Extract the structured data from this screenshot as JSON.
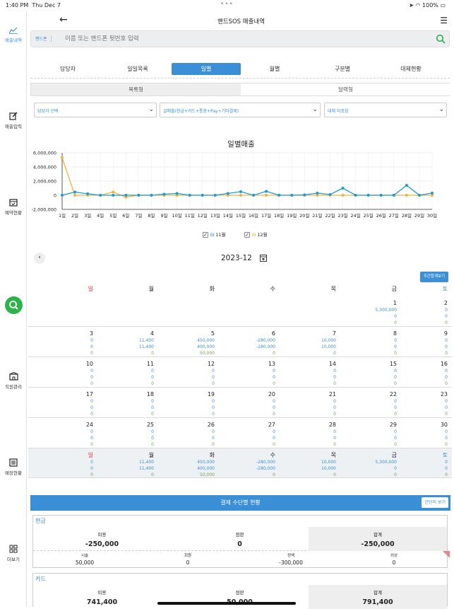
{
  "status": {
    "time": "1:40 PM",
    "date": "Thu Dec 7",
    "battery": "100%"
  },
  "sidebar": {
    "items": [
      {
        "label": "매출내역",
        "icon": "chart-line-icon"
      },
      {
        "label": "매출입력",
        "icon": "edit-icon"
      },
      {
        "label": "예약현황",
        "icon": "calendar-check-icon"
      },
      {
        "label": "",
        "icon": "search-icon"
      },
      {
        "label": "직원관리",
        "icon": "building-icon"
      },
      {
        "label": "매장현황",
        "icon": "list-icon"
      },
      {
        "label": "더보기",
        "icon": "grid-icon"
      }
    ]
  },
  "header": {
    "title": "핸드SOS 매출내역"
  },
  "search": {
    "type": "핸드폰",
    "placeholder": "이름 또는 핸드폰 뒷번호 입력"
  },
  "tabs": [
    "담당자",
    "일일목록",
    "일별",
    "월별",
    "구분별",
    "대체현황"
  ],
  "active_tab": 2,
  "subtabs": [
    "목록형",
    "달력형"
  ],
  "selects": [
    "담당자 선택",
    "실매출(현금+카드+통장+Pay+기타결제)",
    "대체 미포함"
  ],
  "chart_data": {
    "type": "line",
    "title": "일별매출",
    "categories": [
      "1일",
      "2일",
      "3일",
      "4일",
      "5일",
      "6일",
      "7일",
      "8일",
      "9일",
      "10일",
      "11일",
      "12일",
      "13일",
      "14일",
      "15일",
      "16일",
      "17일",
      "18일",
      "19일",
      "20일",
      "21일",
      "22일",
      "23일",
      "24일",
      "25일",
      "26일",
      "27일",
      "28일",
      "29일",
      "30일"
    ],
    "yticks": [
      "6,000,000",
      "4,000,000",
      "2,000,000",
      "0",
      "-2,000,000"
    ],
    "ylim": [
      -2000000,
      6000000
    ],
    "series": [
      {
        "name": "11월",
        "color": "#1e9bd7",
        "values": [
          0,
          450000,
          200000,
          0,
          0,
          0,
          0,
          0,
          150000,
          250000,
          0,
          0,
          0,
          250000,
          500000,
          0,
          550000,
          0,
          0,
          50000,
          300000,
          100000,
          1000000,
          0,
          0,
          0,
          0,
          1400000,
          0,
          300000
        ]
      },
      {
        "name": "12월",
        "color": "#f0b43a",
        "values": [
          5300000,
          0,
          0,
          11400,
          450000,
          -280000,
          10000,
          0,
          0,
          0,
          0,
          0,
          0,
          0,
          0,
          0,
          0,
          0,
          0,
          0,
          0,
          0,
          0,
          0,
          0,
          0,
          0,
          0,
          0,
          0
        ]
      }
    ]
  },
  "calendar": {
    "month": "2023-12",
    "weekly_button": "주간합계보기",
    "dow": [
      "일",
      "월",
      "화",
      "수",
      "목",
      "금",
      "토"
    ],
    "weeks": [
      [
        null,
        null,
        null,
        null,
        null,
        {
          "d": "1",
          "v": [
            "5,300,000",
            "0",
            "0"
          ]
        },
        {
          "d": "2",
          "v": [
            "0",
            "0",
            "0"
          ]
        }
      ],
      [
        {
          "d": "3",
          "v": [
            "0",
            "0",
            "0"
          ]
        },
        {
          "d": "4",
          "v": [
            "11,400",
            "11,400",
            "0"
          ]
        },
        {
          "d": "5",
          "v": [
            "450,000",
            "400,000",
            "50,000"
          ]
        },
        {
          "d": "6",
          "v": [
            "-280,000",
            "-280,000",
            "0"
          ]
        },
        {
          "d": "7",
          "v": [
            "10,000",
            "10,000",
            "0"
          ]
        },
        {
          "d": "8",
          "v": [
            "0",
            "0",
            "0"
          ]
        },
        {
          "d": "9",
          "v": [
            "0",
            "0",
            "0"
          ]
        }
      ],
      [
        {
          "d": "10",
          "v": [
            "0",
            "0",
            "0"
          ]
        },
        {
          "d": "11",
          "v": [
            "0",
            "0",
            "0"
          ]
        },
        {
          "d": "12",
          "v": [
            "0",
            "0",
            "0"
          ]
        },
        {
          "d": "13",
          "v": [
            "0",
            "0",
            "0"
          ]
        },
        {
          "d": "14",
          "v": [
            "0",
            "0",
            "0"
          ]
        },
        {
          "d": "15",
          "v": [
            "0",
            "0",
            "0"
          ]
        },
        {
          "d": "16",
          "v": [
            "0",
            "0",
            "0"
          ]
        }
      ],
      [
        {
          "d": "17",
          "v": [
            "0",
            "0",
            "0"
          ]
        },
        {
          "d": "18",
          "v": [
            "0",
            "0",
            "0"
          ]
        },
        {
          "d": "19",
          "v": [
            "0",
            "0",
            "0"
          ]
        },
        {
          "d": "20",
          "v": [
            "0",
            "0",
            "0"
          ]
        },
        {
          "d": "21",
          "v": [
            "0",
            "0",
            "0"
          ]
        },
        {
          "d": "22",
          "v": [
            "0",
            "0",
            "0"
          ]
        },
        {
          "d": "23",
          "v": [
            "0",
            "0",
            "0"
          ]
        }
      ],
      [
        {
          "d": "24",
          "v": [
            "0",
            "0",
            "0"
          ]
        },
        {
          "d": "25",
          "v": [
            "0",
            "0",
            "0"
          ]
        },
        {
          "d": "26",
          "v": [
            "0",
            "0",
            "0"
          ]
        },
        {
          "d": "27",
          "v": [
            "0",
            "0",
            "0"
          ]
        },
        {
          "d": "28",
          "v": [
            "0",
            "0",
            "0"
          ]
        },
        {
          "d": "29",
          "v": [
            "0",
            "0",
            "0"
          ]
        },
        {
          "d": "30",
          "v": [
            "0",
            "0",
            "0"
          ]
        }
      ]
    ],
    "totals": [
      {
        "d": "일",
        "v": [
          "0",
          "0",
          "0"
        ]
      },
      {
        "d": "월",
        "v": [
          "11,400",
          "11,400",
          "0"
        ]
      },
      {
        "d": "화",
        "v": [
          "450,000",
          "400,000",
          "50,000"
        ]
      },
      {
        "d": "수",
        "v": [
          "-280,000",
          "-280,000",
          "0"
        ]
      },
      {
        "d": "목",
        "v": [
          "10,000",
          "10,000",
          "0"
        ]
      },
      {
        "d": "금",
        "v": [
          "5,300,000",
          "0",
          "0"
        ]
      },
      {
        "d": "토",
        "v": [
          "0",
          "0",
          "0"
        ]
      }
    ]
  },
  "payment": {
    "title": "결제 수단별 현황",
    "simple_button": "간단히 보기",
    "cash": {
      "label": "현금",
      "top": [
        {
          "k": "미용",
          "v": "-250,000"
        },
        {
          "k": "점판",
          "v": "0"
        },
        {
          "k": "합계",
          "v": "-250,000"
        }
      ],
      "bottom": [
        {
          "k": "시술",
          "v": "50,000"
        },
        {
          "k": "회원",
          "v": "0"
        },
        {
          "k": "정액",
          "v": "-300,000"
        },
        {
          "k": "외상",
          "v": "0"
        }
      ]
    },
    "card": {
      "label": "카드",
      "top": [
        {
          "k": "미용",
          "v": "741,400"
        },
        {
          "k": "점판",
          "v": "50,000"
        },
        {
          "k": "합계",
          "v": "791,400"
        }
      ]
    }
  }
}
